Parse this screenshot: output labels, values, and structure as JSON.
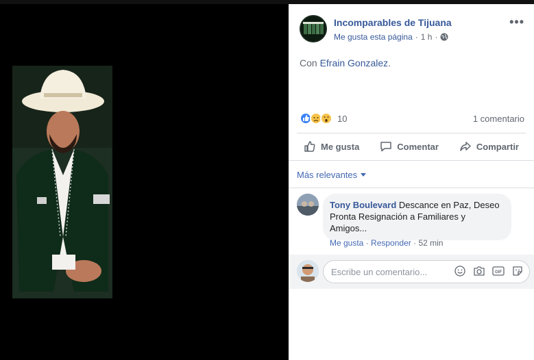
{
  "post": {
    "page_name": "Incomparables de Tijuana",
    "like_page": "Me gusta esta página",
    "dot": "·",
    "time": "1 h",
    "text_prefix": "Con ",
    "tagged": "Efrain Gonzalez",
    "text_suffix": ".",
    "more_icon": "•••"
  },
  "reactions": {
    "count": "10",
    "types": [
      "like-icon",
      "sad-icon",
      "wow-icon"
    ],
    "comment_count": "1 comentario"
  },
  "actions": {
    "like": "Me gusta",
    "comment": "Comentar",
    "share": "Compartir"
  },
  "comments": {
    "filter": "Más relevantes",
    "items": [
      {
        "author": "Tony Boulevard",
        "text": "Descance en Paz, Deseo Pronta Resignación a Familiares y Amigos...",
        "like": "Me gusta",
        "reply": "Responder",
        "time": "52 min"
      }
    ],
    "composer_placeholder": "Escribe un comentario..."
  },
  "colors": {
    "link": "#365899",
    "accent": "#4267b2",
    "muted": "#606770"
  }
}
